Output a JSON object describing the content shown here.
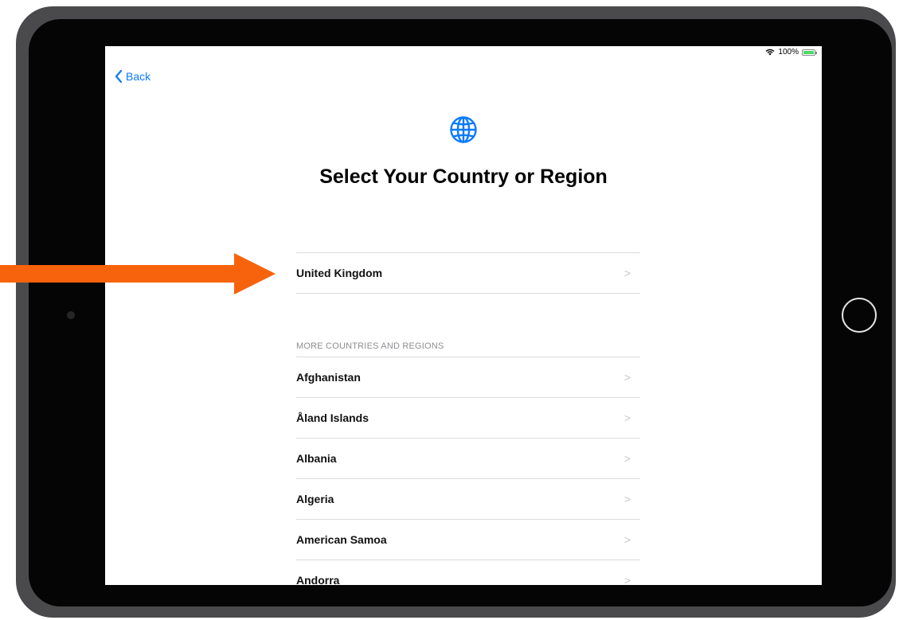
{
  "status_bar": {
    "battery_percent": "100%"
  },
  "nav": {
    "back_label": "Back"
  },
  "header": {
    "icon": "globe-icon",
    "title": "Select Your Country or Region"
  },
  "suggested": [
    {
      "label": "United Kingdom"
    }
  ],
  "more": {
    "header": "MORE COUNTRIES AND REGIONS",
    "items": [
      {
        "label": "Afghanistan"
      },
      {
        "label": "Åland Islands"
      },
      {
        "label": "Albania"
      },
      {
        "label": "Algeria"
      },
      {
        "label": "American Samoa"
      },
      {
        "label": "Andorra"
      }
    ]
  },
  "colors": {
    "accent": "#0a7aff",
    "annotation_arrow": "#f7630c"
  },
  "chevron": ">"
}
